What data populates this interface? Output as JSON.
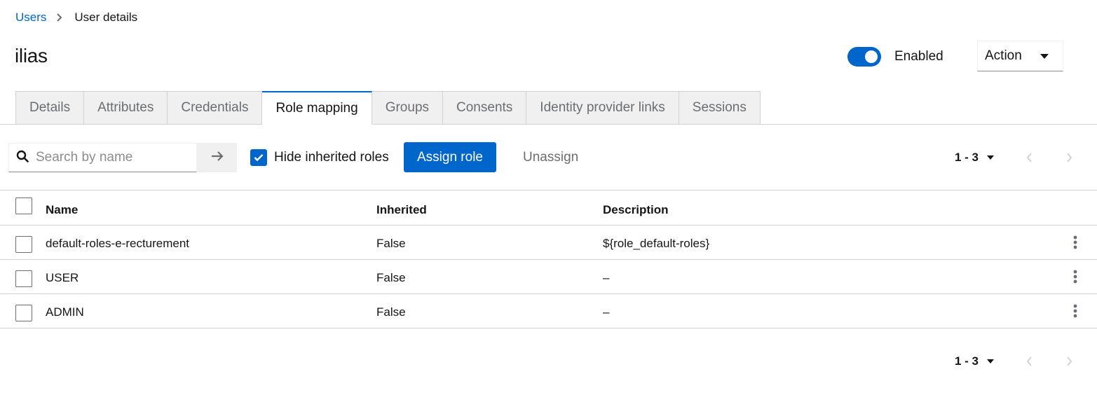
{
  "breadcrumb": {
    "parent": "Users",
    "current": "User details"
  },
  "header": {
    "title": "ilias",
    "enabled_label": "Enabled",
    "action_label": "Action"
  },
  "tabs": [
    {
      "label": "Details"
    },
    {
      "label": "Attributes"
    },
    {
      "label": "Credentials"
    },
    {
      "label": "Role mapping",
      "active": true
    },
    {
      "label": "Groups"
    },
    {
      "label": "Consents"
    },
    {
      "label": "Identity provider links"
    },
    {
      "label": "Sessions"
    }
  ],
  "toolbar": {
    "search_placeholder": "Search by name",
    "search_value": "",
    "hide_inherited_label": "Hide inherited roles",
    "hide_inherited_checked": true,
    "assign_label": "Assign role",
    "unassign_label": "Unassign"
  },
  "pagination": {
    "range": "1 - 3"
  },
  "table": {
    "columns": [
      "Name",
      "Inherited",
      "Description"
    ],
    "rows": [
      {
        "name": "default-roles-e-recturement",
        "inherited": "False",
        "description": "${role_default-roles}"
      },
      {
        "name": "USER",
        "inherited": "False",
        "description": "–"
      },
      {
        "name": "ADMIN",
        "inherited": "False",
        "description": "–"
      }
    ]
  },
  "colors": {
    "primary": "#0066cc",
    "tab_inactive_bg": "#f0f0f0",
    "border": "#d2d2d2"
  },
  "icons": [
    "chevron-right-icon",
    "caret-down-icon",
    "search-icon",
    "arrow-right-icon",
    "check-icon",
    "angle-left-icon",
    "angle-right-icon",
    "kebab-icon"
  ]
}
